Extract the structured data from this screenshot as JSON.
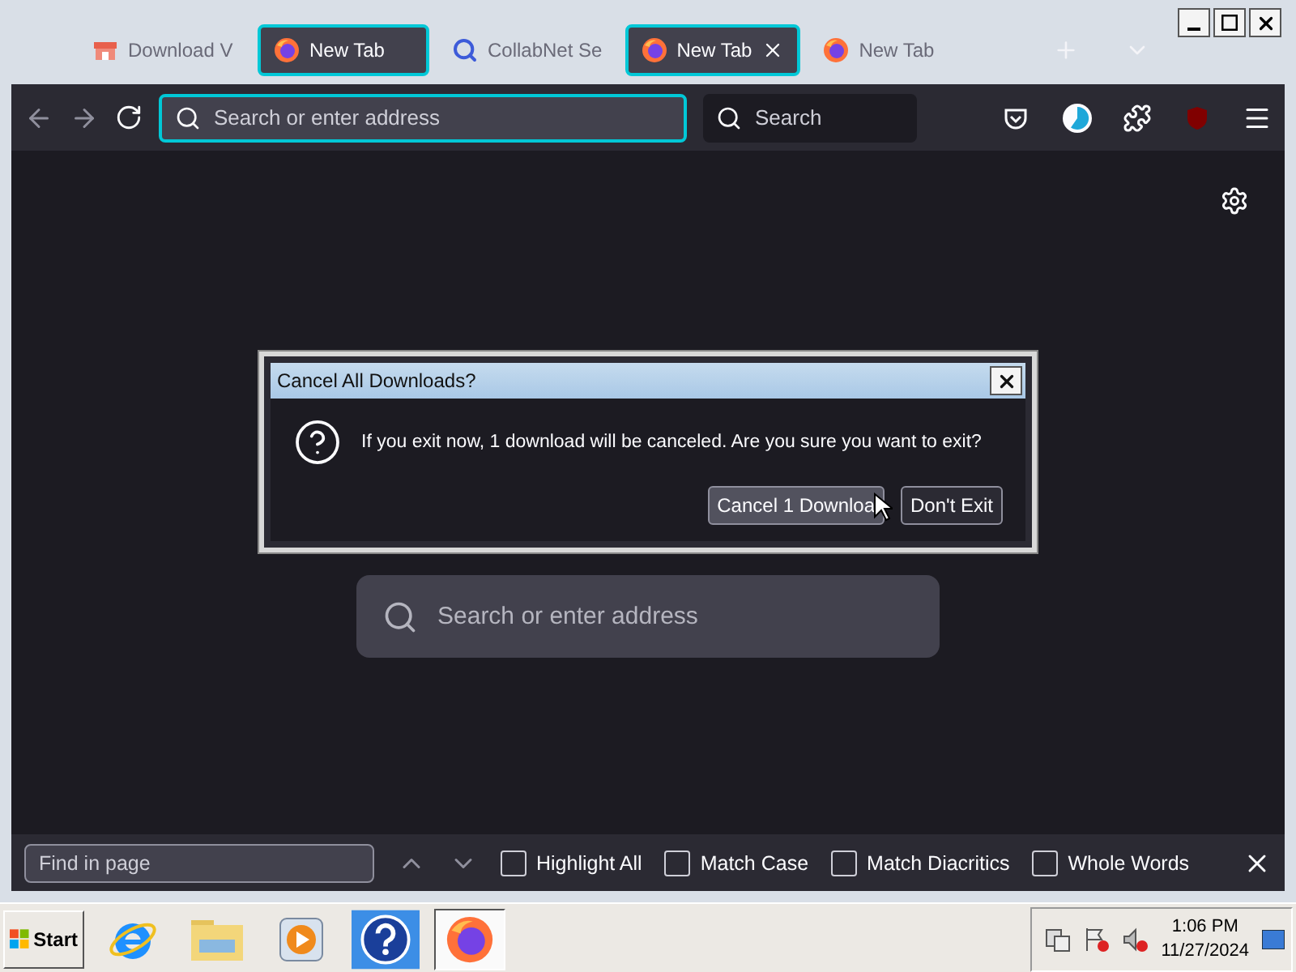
{
  "tabs": [
    {
      "title": "Download V",
      "kind": "store",
      "selected": false,
      "close_button": false
    },
    {
      "title": "New Tab",
      "kind": "firefox",
      "selected": true,
      "close_button": false
    },
    {
      "title": "CollabNet Se",
      "kind": "search",
      "selected": false,
      "close_button": false
    },
    {
      "title": "New Tab",
      "kind": "firefox",
      "selected": true,
      "close_button": true
    },
    {
      "title": "New Tab",
      "kind": "firefox",
      "selected": false,
      "close_button": false
    }
  ],
  "toolbar": {
    "address_placeholder": "Search or enter address",
    "search_placeholder": "Search"
  },
  "dialog": {
    "title": "Cancel All Downloads?",
    "message": "If you exit now, 1 download will be canceled. Are you sure you want to exit?",
    "buttons": [
      {
        "label": "Cancel 1 Downloa",
        "hovered": true
      },
      {
        "label": "Don't Exit",
        "hovered": false
      }
    ]
  },
  "new_tab_search": {
    "placeholder": "Search or enter address"
  },
  "find_bar": {
    "placeholder": "Find in page",
    "options": [
      {
        "label": "Highlight All",
        "checked": false
      },
      {
        "label": "Match Case",
        "checked": false
      },
      {
        "label": "Match Diacritics",
        "checked": false
      },
      {
        "label": "Whole Words",
        "checked": false
      }
    ]
  },
  "taskbar": {
    "start": "Start",
    "apps": [
      {
        "kind": "ie",
        "active": false
      },
      {
        "kind": "folder",
        "active": false
      },
      {
        "kind": "media",
        "active": false
      },
      {
        "kind": "help",
        "active": false
      },
      {
        "kind": "firefox",
        "active": true
      }
    ],
    "time": "1:06 PM",
    "date": "11/27/2024"
  }
}
